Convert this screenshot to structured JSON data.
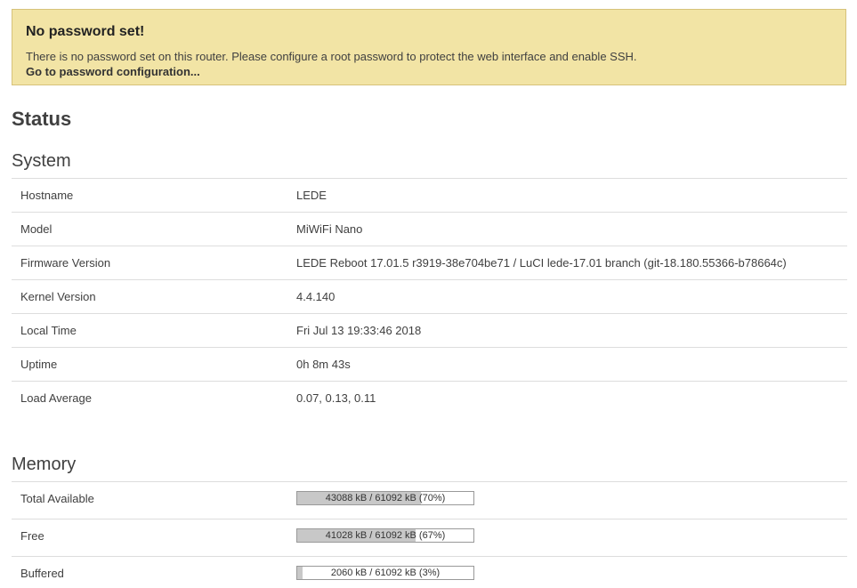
{
  "alert": {
    "title": "No password set!",
    "message": "There is no password set on this router. Please configure a root password to protect the web interface and enable SSH.",
    "link_label": "Go to password configuration..."
  },
  "page_title": "Status",
  "system": {
    "title": "System",
    "rows": [
      {
        "label": "Hostname",
        "value": "LEDE"
      },
      {
        "label": "Model",
        "value": "MiWiFi Nano"
      },
      {
        "label": "Firmware Version",
        "value": "LEDE Reboot 17.01.5 r3919-38e704be71 / LuCI lede-17.01 branch (git-18.180.55366-b78664c)"
      },
      {
        "label": "Kernel Version",
        "value": "4.4.140"
      },
      {
        "label": "Local Time",
        "value": "Fri Jul 13 19:33:46 2018"
      },
      {
        "label": "Uptime",
        "value": "0h 8m 43s"
      },
      {
        "label": "Load Average",
        "value": "0.07, 0.13, 0.11"
      }
    ]
  },
  "memory": {
    "title": "Memory",
    "rows": [
      {
        "label": "Total Available",
        "text": "43088 kB / 61092 kB (70%)",
        "fraction": 0.7
      },
      {
        "label": "Free",
        "text": "41028 kB / 61092 kB (67%)",
        "fraction": 0.67
      },
      {
        "label": "Buffered",
        "text": "2060 kB / 61092 kB (3%)",
        "fraction": 0.03
      }
    ]
  }
}
